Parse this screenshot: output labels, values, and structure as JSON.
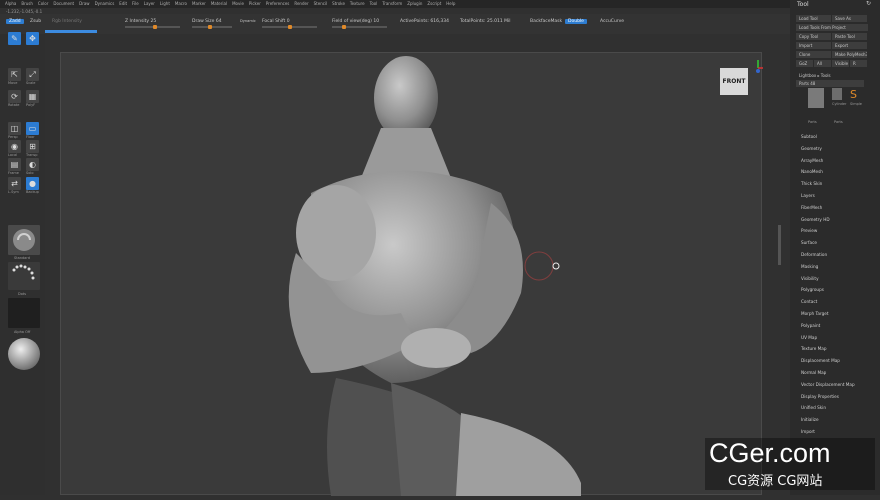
{
  "menu": [
    "Alpha",
    "Brush",
    "Color",
    "Document",
    "Draw",
    "Dynamics",
    "Edit",
    "File",
    "Layer",
    "Light",
    "Macro",
    "Marker",
    "Material",
    "Movie",
    "Picker",
    "Preferences",
    "Render",
    "Stencil",
    "Stroke",
    "Texture",
    "Tool",
    "Transform",
    "Zplugin",
    "Zscript",
    "Help"
  ],
  "coords": "-1.232,-1.045,-0.1",
  "topbar": {
    "mode_left": "Zadd",
    "mode_mid": "Zsub",
    "rgb": "Rgb Intensity",
    "z_intensity": "Z Intensity 25",
    "draw_size": "Draw Size 64",
    "dynamic": "Dynamic",
    "focal_shift": "Focal Shift 0",
    "fov": "Field of view(deg) 10",
    "active_points": "ActivePoints: 616,334",
    "total_points": "TotalPoints: 25.011 Mil",
    "backface": "BackfaceMask",
    "double": "Double",
    "accucurve": "AccuCurve",
    "progress": 0.12
  },
  "leftbar": {
    "buttons": [
      {
        "name": "Move",
        "label": "Move"
      },
      {
        "name": "Scale",
        "label": "Scale"
      },
      {
        "name": "Rotate",
        "label": "Rotate"
      },
      {
        "name": "PolyF",
        "label": "PolyF"
      },
      {
        "name": "Persp",
        "label": "Persp"
      },
      {
        "name": "Floor",
        "label": "Floor"
      },
      {
        "name": "Local",
        "label": "Local"
      },
      {
        "name": "Transp",
        "label": "Transp"
      },
      {
        "name": "Frame",
        "label": "Frame"
      },
      {
        "name": "Solo",
        "label": "Solo"
      },
      {
        "name": "LSym",
        "label": "L.Sym"
      },
      {
        "name": "Backup",
        "label": "Backup"
      }
    ],
    "brush_label": "Standard",
    "stroke_label": "Dots",
    "alpha_label": "Alpha Off"
  },
  "viewport": {
    "nav_cube_label": "FRONT"
  },
  "tool_panel": {
    "title": "Tool",
    "rows": [
      [
        "Load Tool",
        "Save As"
      ],
      [
        "Load Tools From Project",
        ""
      ],
      [
        "Copy Tool",
        "Paste Tool"
      ],
      [
        "Import",
        "Export"
      ],
      [
        "Clone",
        "Make PolyMesh3D"
      ],
      [
        "GoZ",
        "All",
        "Visible",
        "R"
      ]
    ],
    "lightbox": "Lightbox ▸ Tools",
    "parts": "Parts 48",
    "thumbs": [
      "Parts",
      "Cylinder",
      "Simple",
      "Parts"
    ],
    "subpanels": [
      "Subtool",
      "Geometry",
      "ArrayMesh",
      "NanoMesh",
      "Thick Skin",
      "Layers",
      "FiberMesh",
      "Geometry HD",
      "Preview",
      "Surface",
      "Deformation",
      "Masking",
      "Visibility",
      "Polygroups",
      "Contact",
      "Morph Target",
      "Polypaint",
      "UV Map",
      "Texture Map",
      "Displacement Map",
      "Normal Map",
      "Vector Displacement Map",
      "Display Properties",
      "Unified Skin",
      "Initialize",
      "Import"
    ]
  },
  "watermark": {
    "line1": "CGer.com",
    "line2": "CG资源 CG网站"
  },
  "colors": {
    "accent": "#2e7dd1",
    "orange": "#e08a2a",
    "bg": "#303030",
    "viewport": "#3a3a3a"
  }
}
